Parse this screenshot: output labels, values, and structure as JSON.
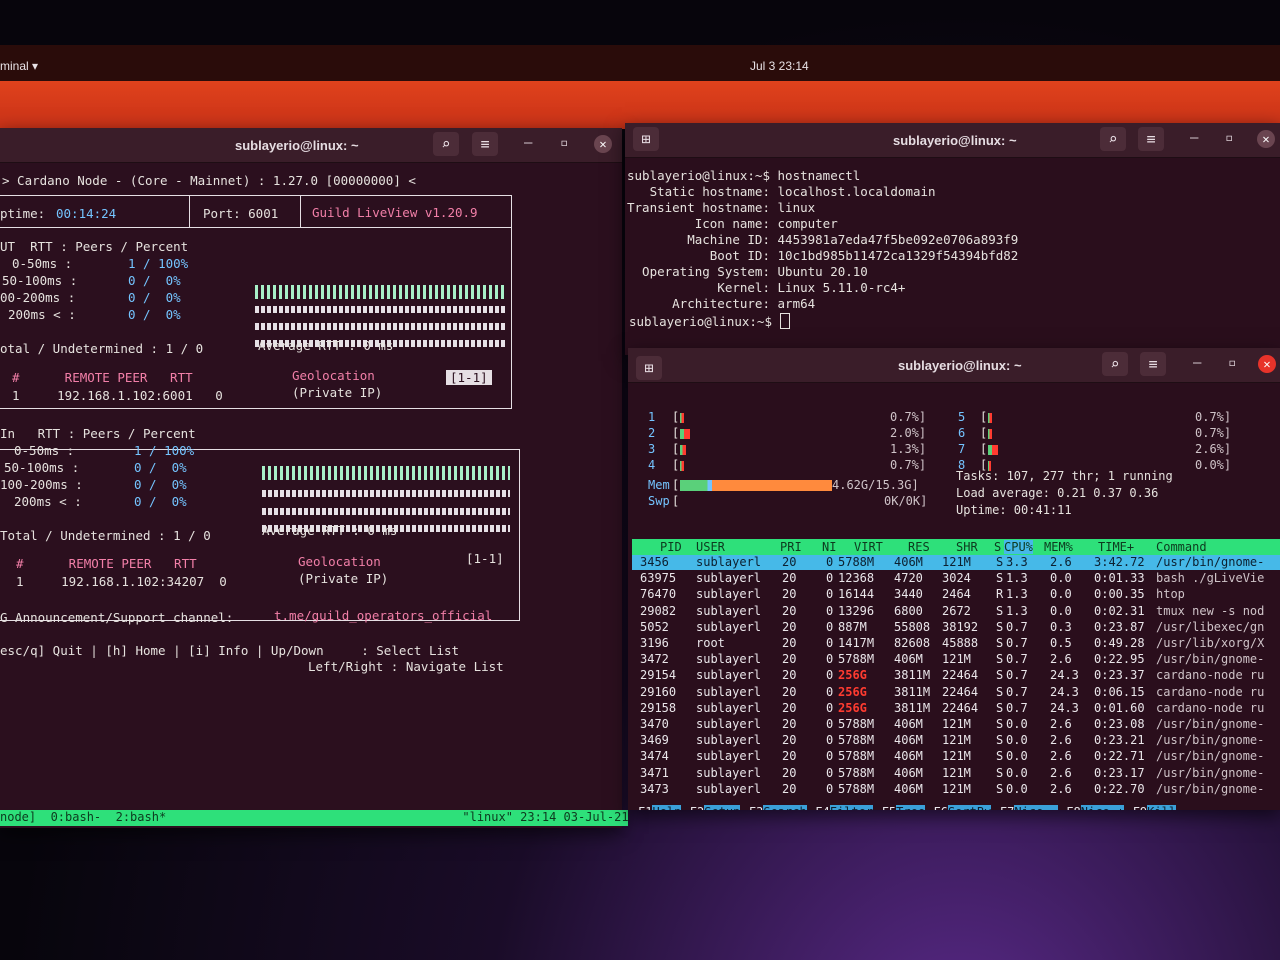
{
  "topbar": {
    "app_label": "minal ▾",
    "clock": "Jul 3  23:14"
  },
  "left_window": {
    "title": "sublayerio@linux: ~",
    "header_line": "> Cardano Node - (Core - Mainnet) : 1.27.0 [00000000] <",
    "uptime_label": "ptime:",
    "uptime_value": "00:14:24",
    "port": "Port: 6001",
    "liveview": "Guild LiveView v1.20.9",
    "out": {
      "head": "UT  RTT : Peers / Percent",
      "rows": [
        {
          "label": "0-50ms :",
          "val": "1 / 100%"
        },
        {
          "label": "50-100ms :",
          "val": "0 /  0%"
        },
        {
          "label": "00-200ms :",
          "val": "0 /  0%"
        },
        {
          "label": "200ms < :",
          "val": "0 /  0%"
        }
      ],
      "total": "otal / Undetermined : 1 / 0",
      "avg": "Average RTT : 0 ms",
      "peer_head": "#      REMOTE PEER   RTT",
      "geo_head": "Geolocation",
      "page": "[1-1]",
      "peer_row": "1     192.168.1.102:6001   0",
      "geo_row": "(Private IP)"
    },
    "in": {
      "head": "In   RTT : Peers / Percent",
      "rows": [
        {
          "label": "0-50ms :",
          "val": "1 / 100%"
        },
        {
          "label": "50-100ms :",
          "val": "0 /  0%"
        },
        {
          "label": "100-200ms :",
          "val": "0 /  0%"
        },
        {
          "label": "200ms < :",
          "val": "0 /  0%"
        }
      ],
      "total": "Total / Undetermined : 1 / 0",
      "avg": "Average RTT : 0 ms",
      "peer_head": "#      REMOTE PEER   RTT",
      "geo_head": "Geolocation",
      "page": "[1-1]",
      "peer_row": "1     192.168.1.102:34207  0",
      "geo_row": "(Private IP)"
    },
    "announce_label": "G Announcement/Support channel:",
    "announce_link": "t.me/guild_operators_official",
    "keys_line1": "esc/q] Quit | [h] Home | [i] Info | Up/Down     : Select List",
    "keys_line2": "Left/Right : Navigate List"
  },
  "tmux": "node]  0:bash-  2:bash*                                         \"linux\" 23:14 03-Jul-21",
  "right_top_window": {
    "title": "sublayerio@linux: ~",
    "lines": [
      "sublayerio@linux:~$ hostnamectl",
      "   Static hostname: localhost.localdomain",
      "Transient hostname: linux",
      "         Icon name: computer",
      "        Machine ID: 4453981a7eda47f5be092e0706a893f9",
      "           Boot ID: 10c1bd985b11472ca1329f54394bfd82",
      "  Operating System: Ubuntu 20.10",
      "            Kernel: Linux 5.11.0-rc4+",
      "      Architecture: arm64",
      "sublayerio@linux:~$ "
    ]
  },
  "htop_window": {
    "title": "sublayerio@linux: ~",
    "cpus_left": [
      {
        "n": "1",
        "pct": "0.7%]",
        "level": 0.02
      },
      {
        "n": "2",
        "pct": "2.0%]",
        "level": 0.05
      },
      {
        "n": "3",
        "pct": "1.3%]",
        "level": 0.03
      },
      {
        "n": "4",
        "pct": "0.7%]",
        "level": 0.02
      }
    ],
    "cpus_right": [
      {
        "n": "5",
        "pct": "0.7%]",
        "level": 0.02
      },
      {
        "n": "6",
        "pct": "0.7%]",
        "level": 0.02
      },
      {
        "n": "7",
        "pct": "2.6%]",
        "level": 0.05
      },
      {
        "n": "8",
        "pct": "0.0%]",
        "level": 0.0
      }
    ],
    "mem_label": "Mem",
    "mem_value": "4.62G/15.3G]",
    "mem_level": 0.3,
    "swp_label": "Swp",
    "swp_value": "0K/0K]",
    "tasks": "Tasks: 107, 277 thr; 1 running",
    "load": "Load average: 0.21 0.37 0.36",
    "uptime": "Uptime: 00:41:11",
    "columns": [
      "PID",
      "USER",
      "PRI",
      "NI",
      "VIRT",
      "RES",
      "SHR",
      "S",
      "CPU%",
      "MEM%",
      "TIME+",
      "Command"
    ],
    "processes": [
      [
        "3456",
        "sublayerl",
        "20",
        "0",
        "5788M",
        "406M",
        "121M",
        "S",
        "3.3",
        "2.6",
        "3:42.72",
        "/usr/bin/gnome-"
      ],
      [
        "63975",
        "sublayerl",
        "20",
        "0",
        "12368",
        "4720",
        "3024",
        "S",
        "1.3",
        "0.0",
        "0:01.33",
        "bash ./gLiveVie"
      ],
      [
        "76470",
        "sublayerl",
        "20",
        "0",
        "16144",
        "3440",
        "2464",
        "R",
        "1.3",
        "0.0",
        "0:00.35",
        "htop"
      ],
      [
        "29082",
        "sublayerl",
        "20",
        "0",
        "13296",
        "6800",
        "2672",
        "S",
        "1.3",
        "0.0",
        "0:02.31",
        "tmux new -s nod"
      ],
      [
        "5052",
        "sublayerl",
        "20",
        "0",
        "887M",
        "55808",
        "38192",
        "S",
        "0.7",
        "0.3",
        "0:23.87",
        "/usr/libexec/gn"
      ],
      [
        "3196",
        "root",
        "20",
        "0",
        "1417M",
        "82608",
        "45888",
        "S",
        "0.7",
        "0.5",
        "0:49.28",
        "/usr/lib/xorg/X"
      ],
      [
        "3472",
        "sublayerl",
        "20",
        "0",
        "5788M",
        "406M",
        "121M",
        "S",
        "0.7",
        "2.6",
        "0:22.95",
        "/usr/bin/gnome-"
      ],
      [
        "29154",
        "sublayerl",
        "20",
        "0",
        "256G",
        "3811M",
        "22464",
        "S",
        "0.7",
        "24.3",
        "0:23.37",
        "cardano-node ru"
      ],
      [
        "29160",
        "sublayerl",
        "20",
        "0",
        "256G",
        "3811M",
        "22464",
        "S",
        "0.7",
        "24.3",
        "0:06.15",
        "cardano-node ru"
      ],
      [
        "29158",
        "sublayerl",
        "20",
        "0",
        "256G",
        "3811M",
        "22464",
        "S",
        "0.7",
        "24.3",
        "0:01.60",
        "cardano-node ru"
      ],
      [
        "3470",
        "sublayerl",
        "20",
        "0",
        "5788M",
        "406M",
        "121M",
        "S",
        "0.0",
        "2.6",
        "0:23.08",
        "/usr/bin/gnome-"
      ],
      [
        "3469",
        "sublayerl",
        "20",
        "0",
        "5788M",
        "406M",
        "121M",
        "S",
        "0.0",
        "2.6",
        "0:23.21",
        "/usr/bin/gnome-"
      ],
      [
        "3474",
        "sublayerl",
        "20",
        "0",
        "5788M",
        "406M",
        "121M",
        "S",
        "0.0",
        "2.6",
        "0:22.71",
        "/usr/bin/gnome-"
      ],
      [
        "3471",
        "sublayerl",
        "20",
        "0",
        "5788M",
        "406M",
        "121M",
        "S",
        "0.0",
        "2.6",
        "0:23.17",
        "/usr/bin/gnome-"
      ],
      [
        "3473",
        "sublayerl",
        "20",
        "0",
        "5788M",
        "406M",
        "121M",
        "S",
        "0.0",
        "2.6",
        "0:22.70",
        "/usr/bin/gnome-"
      ]
    ],
    "fkeys": [
      {
        "k": "F1",
        "l": "Help"
      },
      {
        "k": "F2",
        "l": "Setup"
      },
      {
        "k": "F3",
        "l": "Search"
      },
      {
        "k": "F4",
        "l": "Filter"
      },
      {
        "k": "F5",
        "l": "Tree"
      },
      {
        "k": "F6",
        "l": "SortBy"
      },
      {
        "k": "F7",
        "l": "Nice -"
      },
      {
        "k": "F8",
        "l": "Nice +"
      },
      {
        "k": "F9",
        "l": "Kill"
      }
    ],
    "colors": {
      "header": "#2ee07a",
      "selected": "#46b9e8",
      "warn": "#ff3b30"
    }
  }
}
